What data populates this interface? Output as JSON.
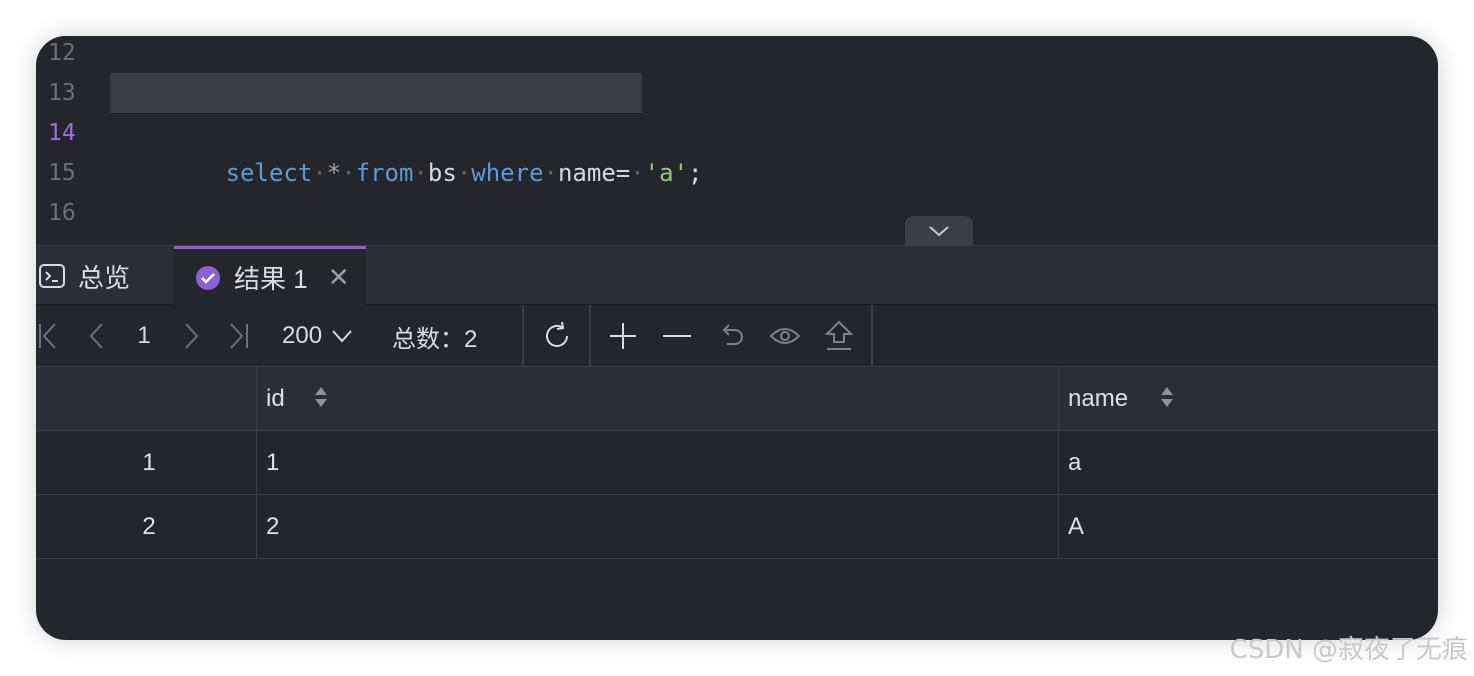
{
  "editor": {
    "lines": [
      {
        "num": "12",
        "code": ""
      },
      {
        "num": "13",
        "code": "select * from bs where name= 'a';"
      },
      {
        "num": "14",
        "code": ""
      },
      {
        "num": "15",
        "code": ""
      },
      {
        "num": "16",
        "code": ""
      }
    ],
    "active_line": "14",
    "tokens": {
      "select": "select",
      "star": "*",
      "from": "from",
      "table": "bs",
      "where": "where",
      "col": "name=",
      "str": "'a'",
      "semi": ";"
    }
  },
  "tabs": [
    {
      "label": "总览",
      "icon": "terminal-icon"
    },
    {
      "label": "结果 1",
      "icon": "check-circle-icon",
      "close": "✕",
      "active": true
    }
  ],
  "toolbar": {
    "page": "1",
    "page_size": "200",
    "total": "总数：2",
    "icons": [
      "first-page-icon",
      "prev-page-icon",
      "next-page-icon",
      "last-page-icon",
      "refresh-icon",
      "add-row-icon",
      "remove-row-icon",
      "undo-icon",
      "view-icon",
      "export-icon"
    ]
  },
  "table": {
    "columns": [
      "id",
      "name"
    ],
    "rows": [
      {
        "rownum": "1",
        "id": "1",
        "name": "a"
      },
      {
        "rownum": "2",
        "id": "2",
        "name": "A"
      }
    ]
  },
  "watermark": "CSDN @寂夜了无痕",
  "colors": {
    "accent": "#8a63d2",
    "keyword": "#5b9bd5",
    "string": "#9fc37a",
    "background": "#24262c"
  }
}
